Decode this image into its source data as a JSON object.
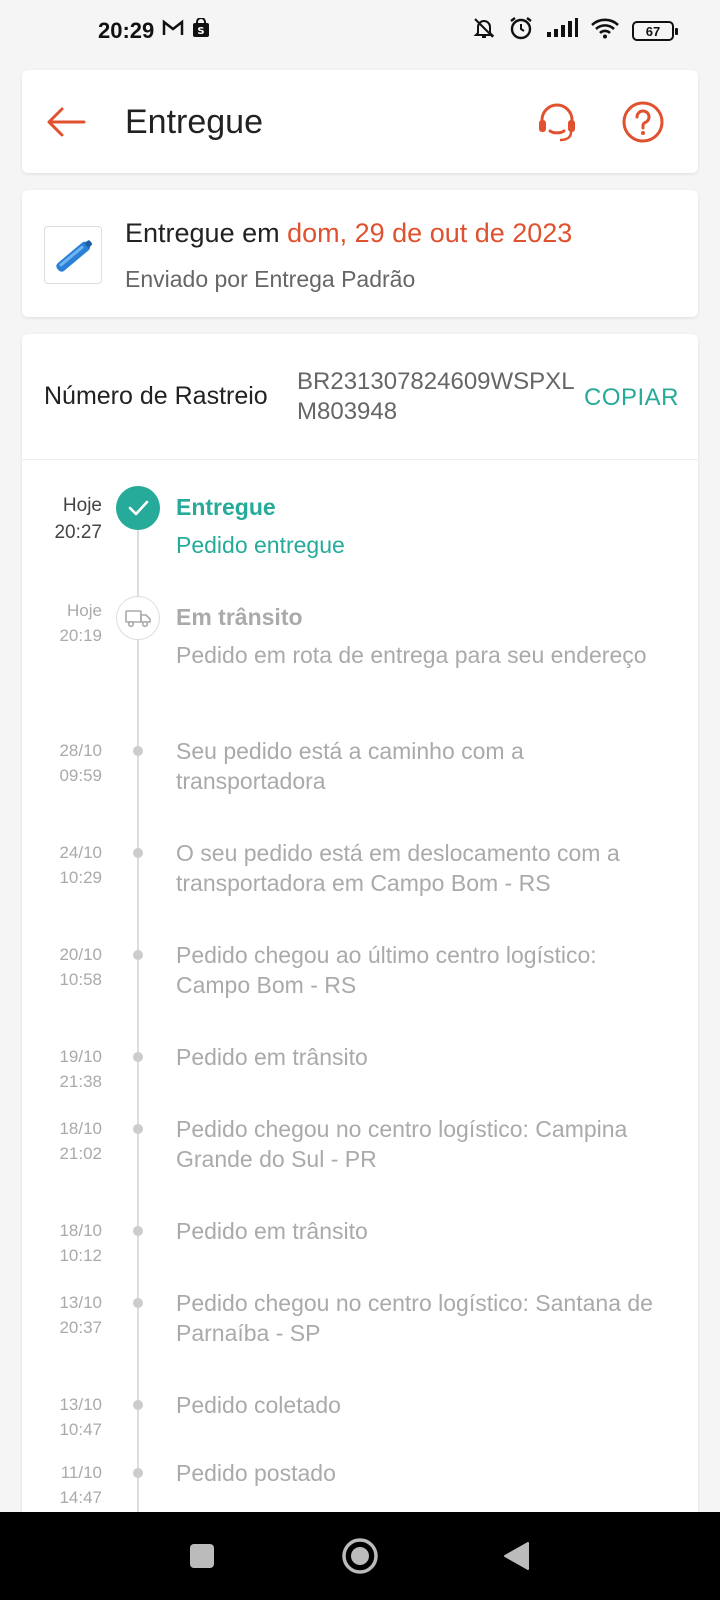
{
  "status_bar": {
    "time": "20:29",
    "battery": "67",
    "icons": [
      "gmail-icon",
      "shop-bag-icon",
      "bell-off-icon",
      "alarm-icon",
      "signal-icon",
      "wifi-icon",
      "battery-icon"
    ]
  },
  "header": {
    "title": "Entregue",
    "back_icon": "arrow-left-icon",
    "support_icon": "headset-icon",
    "help_icon": "question-circle-icon"
  },
  "delivery": {
    "prefix": "Entregue em ",
    "date": "dom, 29 de out de 2023",
    "shipped_by": "Enviado por Entrega Padrão"
  },
  "tracking": {
    "label": "Número de Rastreio",
    "number": "BR231307824609WSPXLM803948",
    "copy_label": "COPIAR"
  },
  "timeline": [
    {
      "date": "Hoje",
      "time": "20:27",
      "title": "Entregue",
      "desc": "Pedido entregue",
      "status": "done"
    },
    {
      "date": "Hoje",
      "time": "20:19",
      "title": "Em trânsito",
      "desc": "Pedido em rota de entrega para seu endereço",
      "status": "transit"
    },
    {
      "date": "28/10",
      "time": "09:59",
      "desc": "Seu pedido está a caminho com a transportadora"
    },
    {
      "date": "24/10",
      "time": "10:29",
      "desc": "O seu pedido está em deslocamento com a transportadora em Campo Bom - RS"
    },
    {
      "date": "20/10",
      "time": "10:58",
      "desc": "Pedido chegou ao último centro logístico: Campo Bom - RS"
    },
    {
      "date": "19/10",
      "time": "21:38",
      "desc": "Pedido em trânsito"
    },
    {
      "date": "18/10",
      "time": "21:02",
      "desc": "Pedido chegou no centro logístico: Campina Grande do Sul - PR"
    },
    {
      "date": "18/10",
      "time": "10:12",
      "desc": "Pedido em trânsito"
    },
    {
      "date": "13/10",
      "time": "20:37",
      "desc": "Pedido chegou no centro logístico: Santana de Parnaíba - SP"
    },
    {
      "date": "13/10",
      "time": "10:47",
      "desc": "Pedido coletado"
    },
    {
      "date": "11/10",
      "time": "14:47",
      "desc": "Pedido postado"
    }
  ],
  "colors": {
    "accent": "#e0522f",
    "success": "#26aa99",
    "muted": "#aaaaaa"
  }
}
